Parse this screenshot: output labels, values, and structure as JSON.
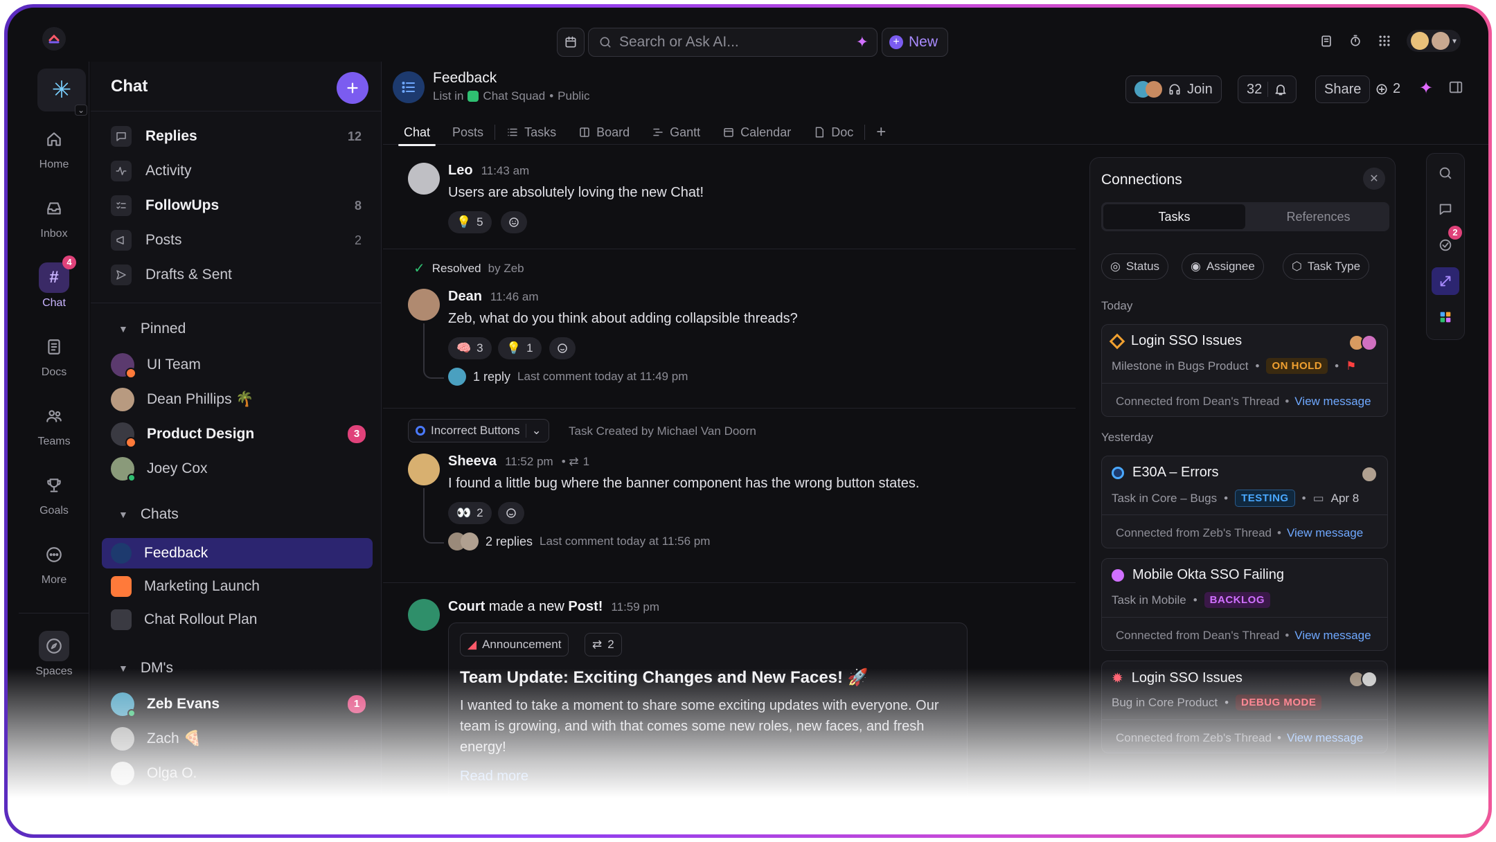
{
  "topbar": {
    "search_placeholder": "Search or Ask AI...",
    "new_label": "New"
  },
  "rail": [
    {
      "label": "Home"
    },
    {
      "label": "Inbox"
    },
    {
      "label": "Chat",
      "badge": "4"
    },
    {
      "label": "Docs"
    },
    {
      "label": "Teams"
    },
    {
      "label": "Goals"
    },
    {
      "label": "More"
    },
    {
      "label": "Spaces"
    }
  ],
  "sidebar": {
    "title": "Chat",
    "items": [
      {
        "label": "Replies",
        "count": "12"
      },
      {
        "label": "Activity",
        "count": ""
      },
      {
        "label": "FollowUps",
        "count": "8"
      },
      {
        "label": "Posts",
        "count": "2"
      },
      {
        "label": "Drafts & Sent",
        "count": ""
      }
    ],
    "pinned_label": "Pinned",
    "pinned": [
      {
        "label": "UI Team"
      },
      {
        "label": "Dean Phillips 🌴"
      },
      {
        "label": "Product Design",
        "badge": "3"
      },
      {
        "label": "Joey Cox"
      }
    ],
    "chats_label": "Chats",
    "chats": [
      {
        "label": "Feedback"
      },
      {
        "label": "Marketing Launch"
      },
      {
        "label": "Chat Rollout Plan"
      }
    ],
    "dms_label": "DM's",
    "dms": [
      {
        "label": "Zeb Evans",
        "badge": "1"
      },
      {
        "label": "Zach 🍕"
      },
      {
        "label": "Olga O."
      }
    ]
  },
  "header": {
    "title": "Feedback",
    "list_in": "List in",
    "space": "Chat Squad",
    "visibility": "Public",
    "join": "Join",
    "count": "32",
    "share": "Share",
    "ai_count": "2",
    "tabs": [
      {
        "label": "Chat"
      },
      {
        "label": "Posts"
      },
      {
        "label": "Tasks"
      },
      {
        "label": "Board"
      },
      {
        "label": "Gantt"
      },
      {
        "label": "Calendar"
      },
      {
        "label": "Doc"
      }
    ]
  },
  "messages": {
    "leo": {
      "name": "Leo",
      "time": "11:43 am",
      "text": "Users are absolutely loving the new Chat!",
      "r1_emoji": "💡",
      "r1_count": "5"
    },
    "resolved": {
      "label": "Resolved",
      "by": "by Zeb"
    },
    "dean": {
      "name": "Dean",
      "time": "11:46 am",
      "text": "Zeb, what do you think about adding collapsible threads?",
      "r1_emoji": "🧠",
      "r1_count": "3",
      "r2_emoji": "💡",
      "r2_count": "1",
      "replies": "1 reply",
      "last": "Last comment today at 11:49 pm"
    },
    "task": {
      "pill": "Incorrect Buttons",
      "created": "Task Created by Michael Van Doorn"
    },
    "sheeva": {
      "name": "Sheeva",
      "time": "11:52 pm",
      "links": "1",
      "text": "I found a little bug where the banner component has the wrong button states.",
      "r1_emoji": "👀",
      "r1_count": "2",
      "replies": "2 replies",
      "last": "Last comment today at 11:56 pm"
    },
    "court": {
      "name": "Court",
      "action": "made a new",
      "post_word": "Post!",
      "time": "11:59 pm",
      "tag": "Announcement",
      "links": "2",
      "title": "Team Update: Exciting Changes and New Faces! 🚀",
      "body": "I wanted to take a moment to share some exciting updates with everyone. Our team is growing, and with that comes some new roles, new faces, and fresh energy!",
      "read_more": "Read more"
    }
  },
  "connections": {
    "title": "Connections",
    "tab_tasks": "Tasks",
    "tab_refs": "References",
    "filters": [
      "Status",
      "Assignee",
      "Task Type"
    ],
    "today": "Today",
    "yesterday": "Yesterday",
    "cards": [
      {
        "title": "Login SSO Issues",
        "sub": "Milestone in Bugs Product",
        "tag": "ON HOLD",
        "from": "Connected from Dean's Thread",
        "link": "View message"
      },
      {
        "title": "E30A – Errors",
        "sub": "Task in Core – Bugs",
        "tag": "TESTING",
        "date": "Apr 8",
        "from": "Connected from Zeb's Thread",
        "link": "View message"
      },
      {
        "title": "Mobile Okta SSO Failing",
        "sub": "Task in Mobile",
        "tag": "BACKLOG",
        "from": "Connected from Dean's Thread",
        "link": "View message"
      },
      {
        "title": "Login SSO Issues",
        "sub": "Bug in Core Product",
        "tag": "DEBUG MODE",
        "from": "Connected from Zeb's Thread",
        "link": "View message"
      }
    ]
  },
  "right_rail": {
    "badge": "2"
  },
  "colors": {
    "accent": "#7b5cf0",
    "link": "#6fa8ff",
    "on_hold": "#f0a030",
    "testing": "#4aa8ff",
    "backlog": "#d070ff",
    "debug": "#ff5a6a"
  }
}
